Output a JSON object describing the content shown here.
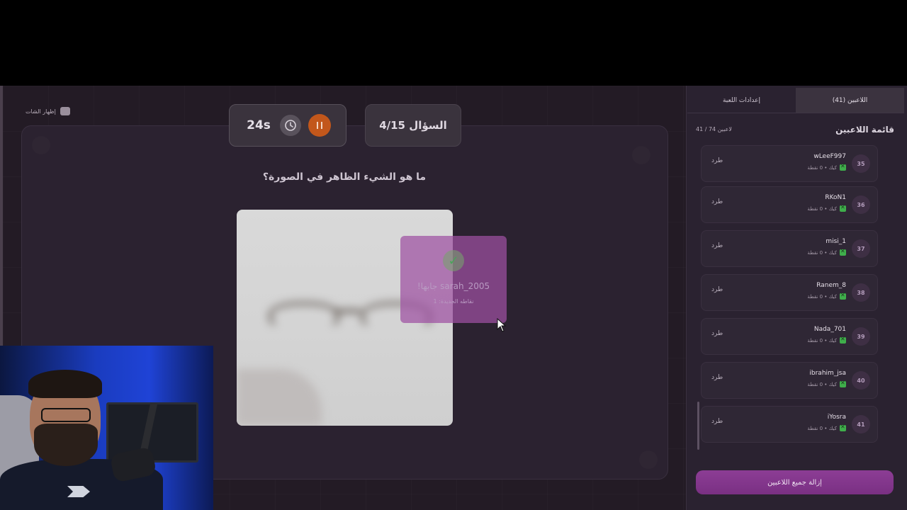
{
  "game": {
    "chat_toggle_label": "إظهار الشات",
    "timer": "24s",
    "question_counter": "السؤال 4/15",
    "question": "ما هو الشيء الظاهر في الصورة؟",
    "correct_popup": {
      "title": "sarah_2005 جابها!",
      "subtitle": "نقاطه الجديدة: 1"
    }
  },
  "sidebar": {
    "tabs": [
      {
        "label": "إعدادات اللعبة",
        "active": false
      },
      {
        "label": "اللاعبين (41)",
        "active": true
      }
    ],
    "list_title": "قائمة اللاعبين",
    "list_count": "41 / 74 لاعبين",
    "kick_label": "طرد",
    "remove_all_label": "إزالة جميع اللاعبين",
    "players": [
      {
        "num": "35",
        "name": "wLeeF997",
        "meta": "كيك • 0 نقطة"
      },
      {
        "num": "36",
        "name": "RKoN1",
        "meta": "كيك • 0 نقطة"
      },
      {
        "num": "37",
        "name": "misi_1",
        "meta": "كيك • 0 نقطة"
      },
      {
        "num": "38",
        "name": "Ranem_8",
        "meta": "كيك • 0 نقطة"
      },
      {
        "num": "39",
        "name": "Nada_701",
        "meta": "كيك • 0 نقطة"
      },
      {
        "num": "40",
        "name": "ibrahim_jsa",
        "meta": "كيك • 0 نقطة"
      },
      {
        "num": "41",
        "name": "iYosra",
        "meta": "كيك • 0 نقطة"
      }
    ]
  },
  "colors": {
    "accent": "#7a3083",
    "pause": "#c2571b",
    "status_green": "#3fae4b"
  }
}
